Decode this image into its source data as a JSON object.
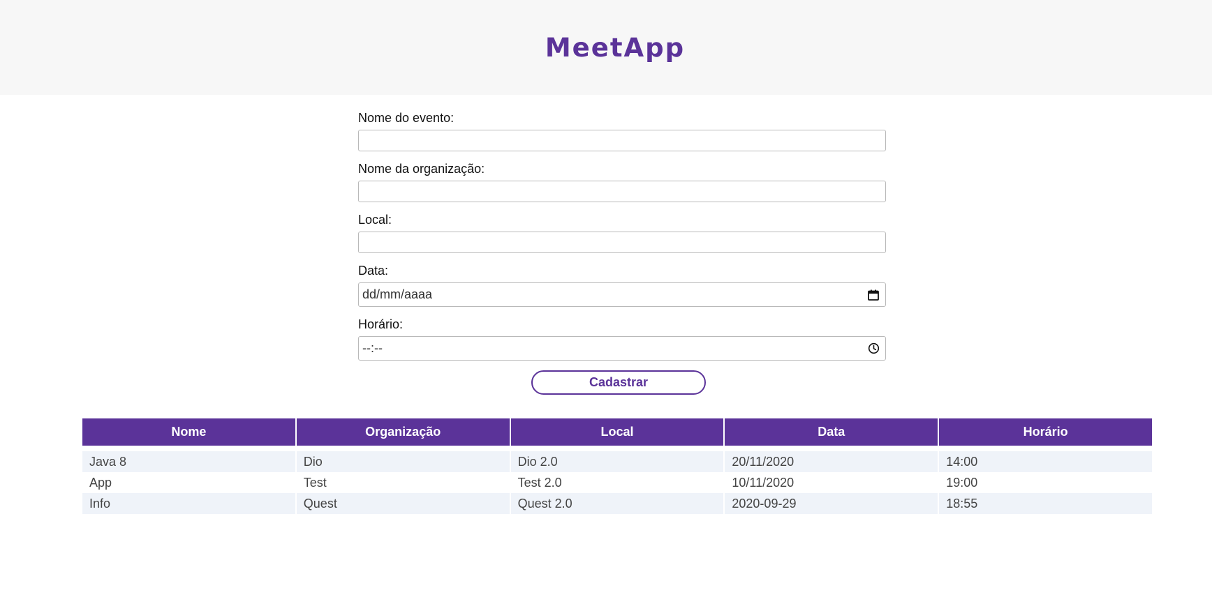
{
  "header": {
    "title": "MeetApp"
  },
  "form": {
    "event_name_label": "Nome do evento:",
    "organization_label": "Nome da organização:",
    "location_label": "Local:",
    "date_label": "Data:",
    "date_placeholder": "dd/mm/aaaa",
    "time_label": "Horário:",
    "time_placeholder": "--:--",
    "submit_label": "Cadastrar"
  },
  "table": {
    "columns": [
      "Nome",
      "Organização",
      "Local",
      "Data",
      "Horário"
    ],
    "rows": [
      [
        "Java 8",
        "Dio",
        "Dio 2.0",
        "20/11/2020",
        "14:00"
      ],
      [
        "App",
        "Test",
        "Test 2.0",
        "10/11/2020",
        "19:00"
      ],
      [
        "Info",
        "Quest",
        "Quest 2.0",
        "2020-09-29",
        "18:55"
      ]
    ]
  },
  "colors": {
    "accent": "#5b3399",
    "header_bg": "#f7f7f7",
    "row_stripe": "#eff3f9"
  }
}
